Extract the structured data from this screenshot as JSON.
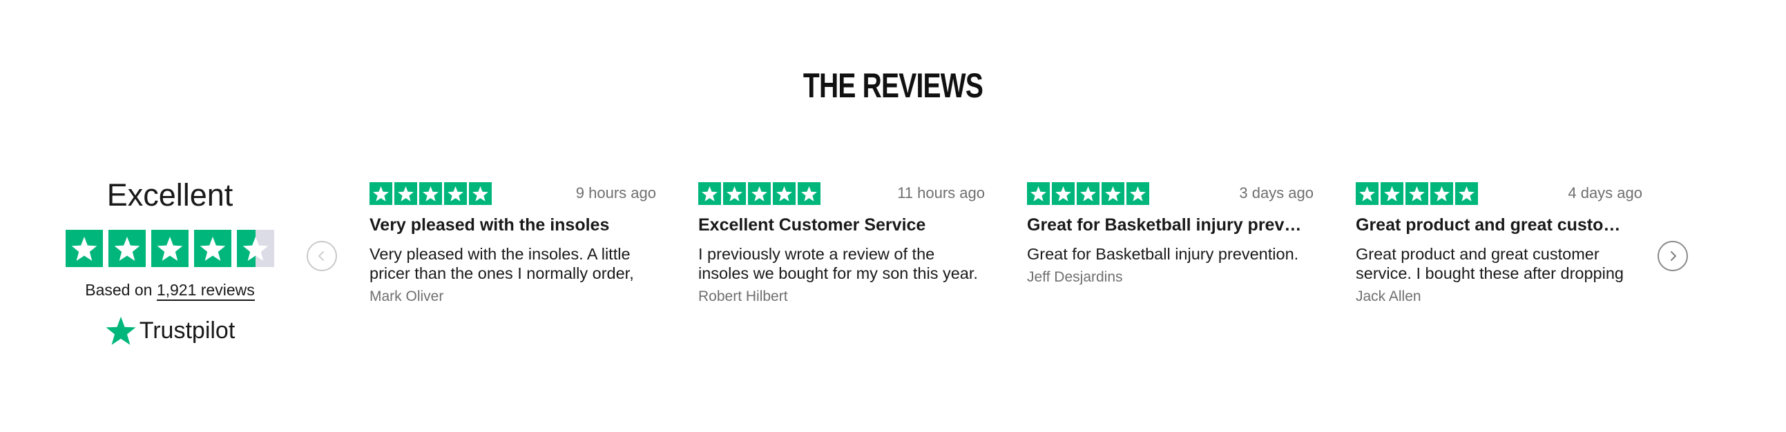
{
  "section": {
    "title": "THE REVIEWS"
  },
  "summary": {
    "rating_word": "Excellent",
    "stars_filled": 4.5,
    "stars_total": 5,
    "based_on_prefix": "Based on",
    "reviews_link": "1,921 reviews",
    "brand": "Trustpilot"
  },
  "colors": {
    "star_green": "#00b67a",
    "star_empty": "#dcdce6"
  },
  "navigation": {
    "prev_icon": "chevron-left-icon",
    "next_icon": "chevron-right-icon"
  },
  "reviews": [
    {
      "stars": 5,
      "time": "9 hours ago",
      "title": "Very pleased with the insoles",
      "body": "Very pleased with the insoles. A little pricer than the ones I normally order,",
      "author": "Mark Oliver"
    },
    {
      "stars": 5,
      "time": "11 hours ago",
      "title": "Excellent Customer Service",
      "body": "I previously wrote a review of the insoles we bought for my son this year.",
      "author": "Robert Hilbert"
    },
    {
      "stars": 5,
      "time": "3 days ago",
      "title": "Great for Basketball injury prev…",
      "body": "Great for Basketball injury prevention.",
      "author": "Jeff Desjardins"
    },
    {
      "stars": 5,
      "time": "4 days ago",
      "title": "Great product and great custo…",
      "body": "Great product and great customer service. I bought these after dropping",
      "author": "Jack Allen"
    }
  ]
}
